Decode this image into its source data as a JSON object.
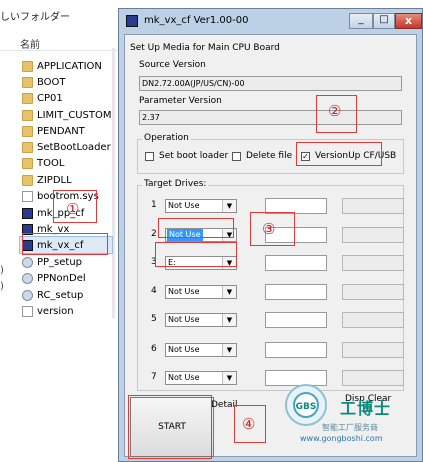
{
  "explorer": {
    "title_fragment": "しいフォルダー",
    "column_name": "名前",
    "side_items": [
      ")",
      ")"
    ],
    "files": [
      {
        "name": "APPLICATION",
        "icon": "folder-icon"
      },
      {
        "name": "BOOT",
        "icon": "folder-icon"
      },
      {
        "name": "CP01",
        "icon": "folder-icon"
      },
      {
        "name": "LIMIT_CUSTOM",
        "icon": "folder-icon"
      },
      {
        "name": "PENDANT",
        "icon": "folder-icon"
      },
      {
        "name": "SetBootLoader",
        "icon": "folder-icon"
      },
      {
        "name": "TOOL",
        "icon": "folder-icon"
      },
      {
        "name": "ZIPDLL",
        "icon": "folder-icon"
      },
      {
        "name": "bootrom.sys",
        "icon": "system-file-icon"
      },
      {
        "name": "mk_pp_cf",
        "icon": "application-icon"
      },
      {
        "name": "mk_vx",
        "icon": "application-icon"
      },
      {
        "name": "mk_vx_cf",
        "icon": "application-icon"
      },
      {
        "name": "PP_setup",
        "icon": "settings-file-icon"
      },
      {
        "name": "PPNonDel",
        "icon": "settings-file-icon"
      },
      {
        "name": "RC_setup",
        "icon": "settings-file-icon"
      },
      {
        "name": "version",
        "icon": "blank-file-icon"
      }
    ]
  },
  "dialog": {
    "title": "mk_vx_cf Ver1.00-00",
    "setup_media_label": "Set Up Media for Main CPU Board",
    "source_version_label": "Source Version",
    "source_version_value": "DN2.72.00A(JP/US/CN)-00",
    "parameter_version_label": "Parameter Version",
    "parameter_version_value": "2.37",
    "operation": {
      "group_label": "Operation",
      "options": [
        {
          "label": "Set boot loader",
          "checked": false
        },
        {
          "label": "Delete file",
          "checked": false
        },
        {
          "label": "VersionUp CF/USB",
          "checked": true
        }
      ]
    },
    "target_drives": {
      "group_label": "Target Drives:",
      "rows": [
        {
          "num": "1",
          "value": "Not Use"
        },
        {
          "num": "2",
          "value": "Not Use"
        },
        {
          "num": "3",
          "value": "E:"
        },
        {
          "num": "4",
          "value": "Not Use"
        },
        {
          "num": "5",
          "value": "Not Use"
        },
        {
          "num": "6",
          "value": "Not Use"
        },
        {
          "num": "7",
          "value": "Not Use"
        }
      ]
    },
    "start_label": "START",
    "detail_label": "Detail",
    "disp_clear_label": "Disp Clear",
    "close_glyph": "x",
    "min_glyph": "_",
    "max_glyph": "□"
  },
  "annotations": [
    "①",
    "②",
    "③",
    "④"
  ],
  "watermark": {
    "brand": "工博士",
    "tagline": "智能工厂服务商",
    "url": "www.gongboshi.com",
    "logo_letters": "GBS",
    "colors": {
      "brand": "#0b8b7c",
      "url": "#2d74b8"
    }
  }
}
